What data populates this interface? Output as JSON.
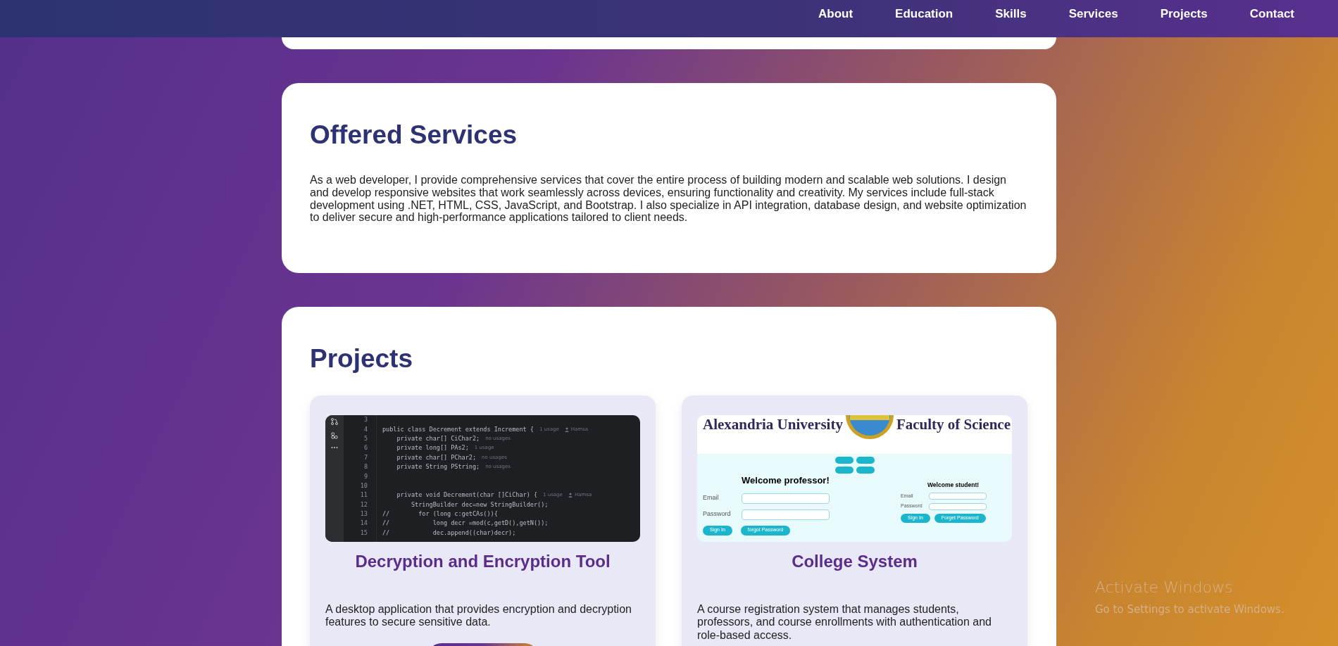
{
  "navbar": {
    "links": [
      {
        "label": "About"
      },
      {
        "label": "Education"
      },
      {
        "label": "Skills"
      },
      {
        "label": "Services"
      },
      {
        "label": "Projects"
      },
      {
        "label": "Contact"
      }
    ]
  },
  "services": {
    "title": "Offered Services",
    "text": "As a web developer, I provide comprehensive services that cover the entire process of building modern and scalable web solutions. I design and develop responsive websites that work seamlessly across devices, ensuring functionality and creativity. My services include full-stack development using .NET, HTML, CSS, JavaScript, and Bootstrap. I also specialize in API integration, database design, and website optimization to deliver secure and high-performance applications tailored to client needs."
  },
  "projects": {
    "title": "Projects",
    "items": [
      {
        "title": "Decryption and Encryption Tool",
        "description": "A desktop application that provides encryption and decryption features to secure sensitive data.",
        "has_button": true,
        "screenshot": {
          "kind": "code_editor",
          "lines": [
            {
              "number": "3"
            },
            {
              "number": "4",
              "code": "public class Decrement extends Increment {",
              "usage": "1 usage",
              "author": "Hamsa"
            },
            {
              "number": "5",
              "code": "    private char[] CiChar2;",
              "usage": "no usages"
            },
            {
              "number": "6",
              "code": "    private long[] PAs2;",
              "usage": "1 usage"
            },
            {
              "number": "7",
              "code": "    private char[] PChar2;",
              "usage": "no usages"
            },
            {
              "number": "8",
              "code": "    private String PString;",
              "usage": "no usages"
            },
            {
              "number": "9"
            },
            {
              "number": "10"
            },
            {
              "number": "11",
              "code": "    private void Decrement(char []CiChar) {",
              "usage": "1 usage",
              "author": "Hamsa"
            },
            {
              "number": "12",
              "code": "        StringBuilder dec=new StringBuilder();"
            },
            {
              "number": "13",
              "code": "//        for (long c:getCAs()){"
            },
            {
              "number": "14",
              "code": "//            long decr =mod(c,getD(),getN());"
            },
            {
              "number": "15",
              "code": "//            dec.append((char)decr);"
            }
          ]
        }
      },
      {
        "title": "College System",
        "description": "A course registration system that manages students, professors, and course enrollments with authentication and role-based access.",
        "has_button": false,
        "screenshot": {
          "kind": "login_page",
          "header_left": "Alexandria University",
          "header_right": "Faculty of Science",
          "professor": {
            "heading": "Welcome professor!",
            "email_label": "Email",
            "password_label": "Password",
            "sign_in": "Sign In",
            "forgot": "forgot Password"
          },
          "student": {
            "heading": "Welcome student!",
            "email_label": "Email",
            "password_label": "Password",
            "sign_in": "Sign In",
            "forgot": "Forget Password"
          }
        }
      }
    ]
  },
  "overlay": {
    "title": "Activate Windows",
    "subtitle": "Go to Settings to activate Windows."
  }
}
